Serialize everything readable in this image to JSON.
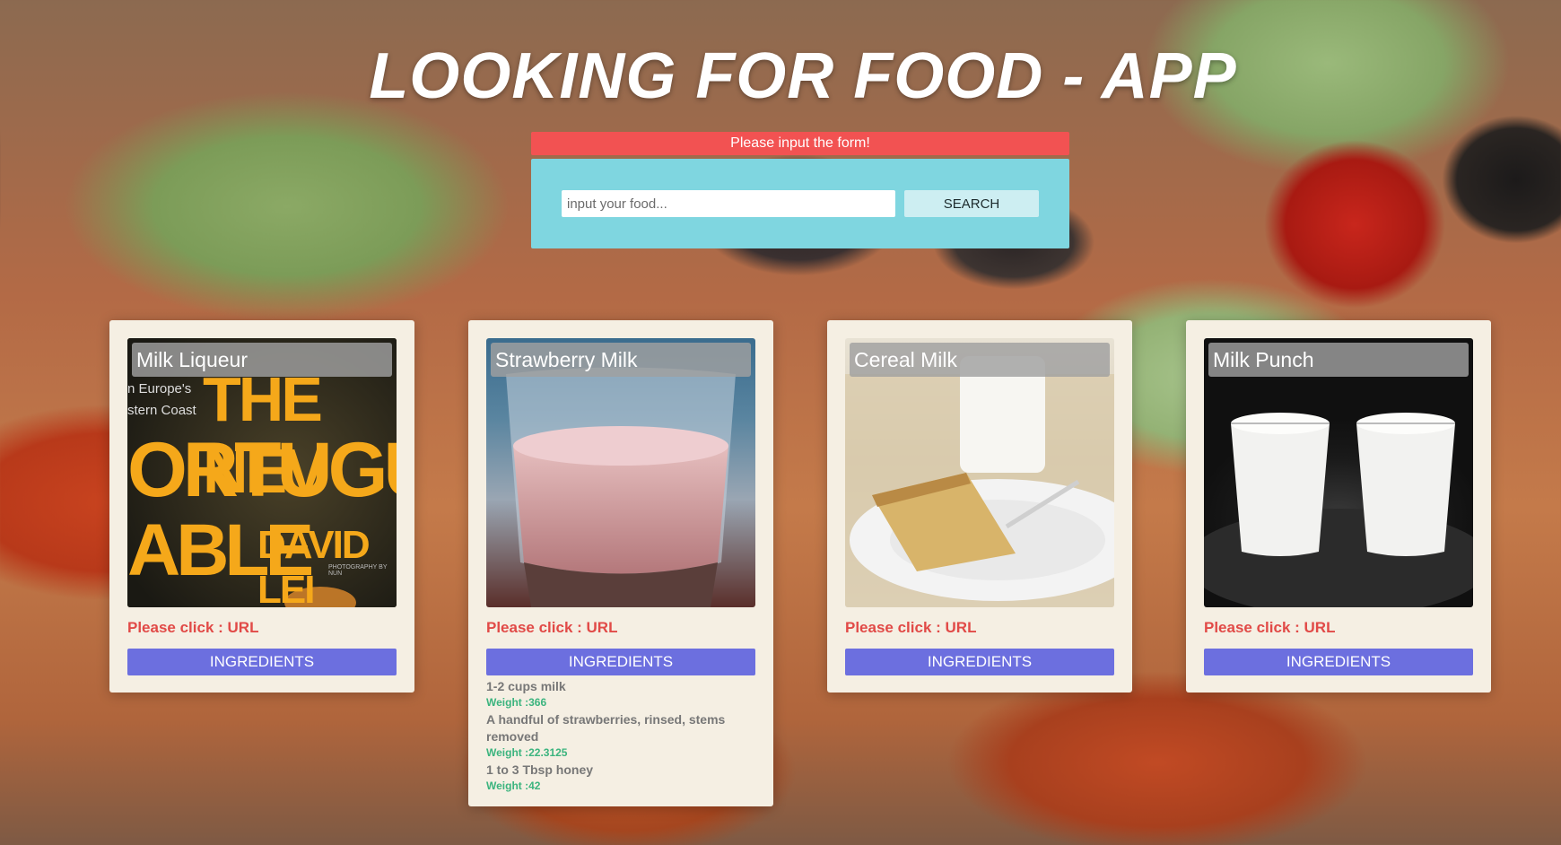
{
  "app": {
    "title": "LOOKING FOR FOOD - APP"
  },
  "alert": {
    "text": "Please input the form!"
  },
  "search": {
    "placeholder": "input your food...",
    "value": "",
    "button_label": "SEARCH"
  },
  "colors": {
    "alert": "#f25252",
    "panel": "#7fd6e0",
    "card_bg": "#f5efe3",
    "link": "#e14a47",
    "ingredients_button": "#6c6fdf",
    "weight": "#3bb47e"
  },
  "cards": [
    {
      "title": "Milk Liqueur",
      "link_text": "Please click : URL",
      "button_label": "INGREDIENTS",
      "image_text": [
        "n Europe's",
        "stern Coast",
        "THE NEV",
        "ORTUGUES",
        "ABLE",
        "DAVID LEI",
        "PHOTOGRAPHY BY NUN"
      ]
    },
    {
      "title": "Strawberry Milk",
      "link_text": "Please click : URL",
      "button_label": "INGREDIENTS",
      "ingredients": [
        {
          "text": "1-2 cups milk",
          "weight": "Weight :366"
        },
        {
          "text": "A handful of strawberries, rinsed, stems removed",
          "weight": "Weight :22.3125"
        },
        {
          "text": "1 to 3 Tbsp honey",
          "weight": "Weight :42"
        }
      ]
    },
    {
      "title": "Cereal Milk",
      "link_text": "Please click : URL",
      "button_label": "INGREDIENTS"
    },
    {
      "title": "Milk Punch",
      "link_text": "Please click : URL",
      "button_label": "INGREDIENTS"
    }
  ]
}
